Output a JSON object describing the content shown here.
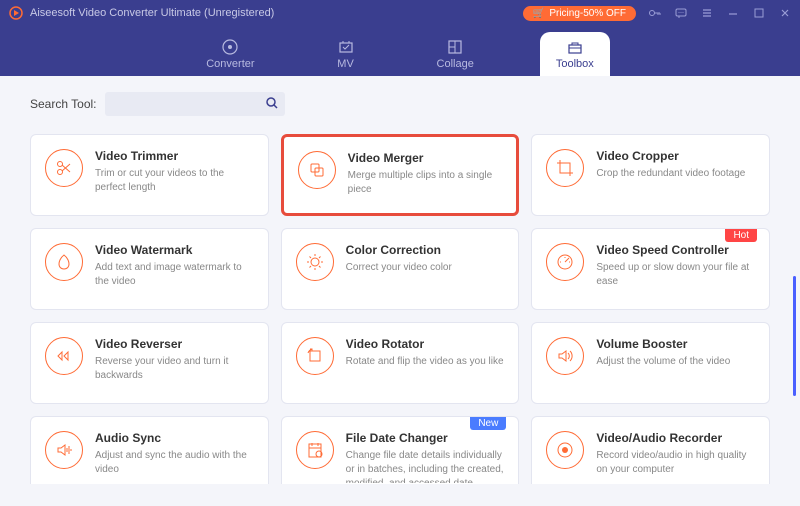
{
  "titlebar": {
    "title": "Aiseesoft Video Converter Ultimate (Unregistered)",
    "pricing_label": "Pricing-50% OFF"
  },
  "nav": {
    "items": [
      {
        "label": "Converter"
      },
      {
        "label": "MV"
      },
      {
        "label": "Collage"
      },
      {
        "label": "Toolbox"
      }
    ]
  },
  "search": {
    "label": "Search Tool:",
    "placeholder": ""
  },
  "tools": [
    {
      "title": "Video Trimmer",
      "desc": "Trim or cut your videos to the perfect length",
      "icon": "trimmer",
      "highlight": false,
      "badge": null
    },
    {
      "title": "Video Merger",
      "desc": "Merge multiple clips into a single piece",
      "icon": "merger",
      "highlight": true,
      "badge": null
    },
    {
      "title": "Video Cropper",
      "desc": "Crop the redundant video footage",
      "icon": "cropper",
      "highlight": false,
      "badge": null
    },
    {
      "title": "Video Watermark",
      "desc": "Add text and image watermark to the video",
      "icon": "watermark",
      "highlight": false,
      "badge": null
    },
    {
      "title": "Color Correction",
      "desc": "Correct your video color",
      "icon": "color",
      "highlight": false,
      "badge": null
    },
    {
      "title": "Video Speed Controller",
      "desc": "Speed up or slow down your file at ease",
      "icon": "speed",
      "highlight": false,
      "badge": "Hot"
    },
    {
      "title": "Video Reverser",
      "desc": "Reverse your video and turn it backwards",
      "icon": "reverser",
      "highlight": false,
      "badge": null
    },
    {
      "title": "Video Rotator",
      "desc": "Rotate and flip the video as you like",
      "icon": "rotator",
      "highlight": false,
      "badge": null
    },
    {
      "title": "Volume Booster",
      "desc": "Adjust the volume of the video",
      "icon": "volume",
      "highlight": false,
      "badge": null
    },
    {
      "title": "Audio Sync",
      "desc": "Adjust and sync the audio with the video",
      "icon": "audiosync",
      "highlight": false,
      "badge": null
    },
    {
      "title": "File Date Changer",
      "desc": "Change file date details individually or in batches, including the created, modified, and accessed date",
      "icon": "date",
      "highlight": false,
      "badge": "New"
    },
    {
      "title": "Video/Audio Recorder",
      "desc": "Record video/audio in high quality on your computer",
      "icon": "recorder",
      "highlight": false,
      "badge": null
    }
  ]
}
